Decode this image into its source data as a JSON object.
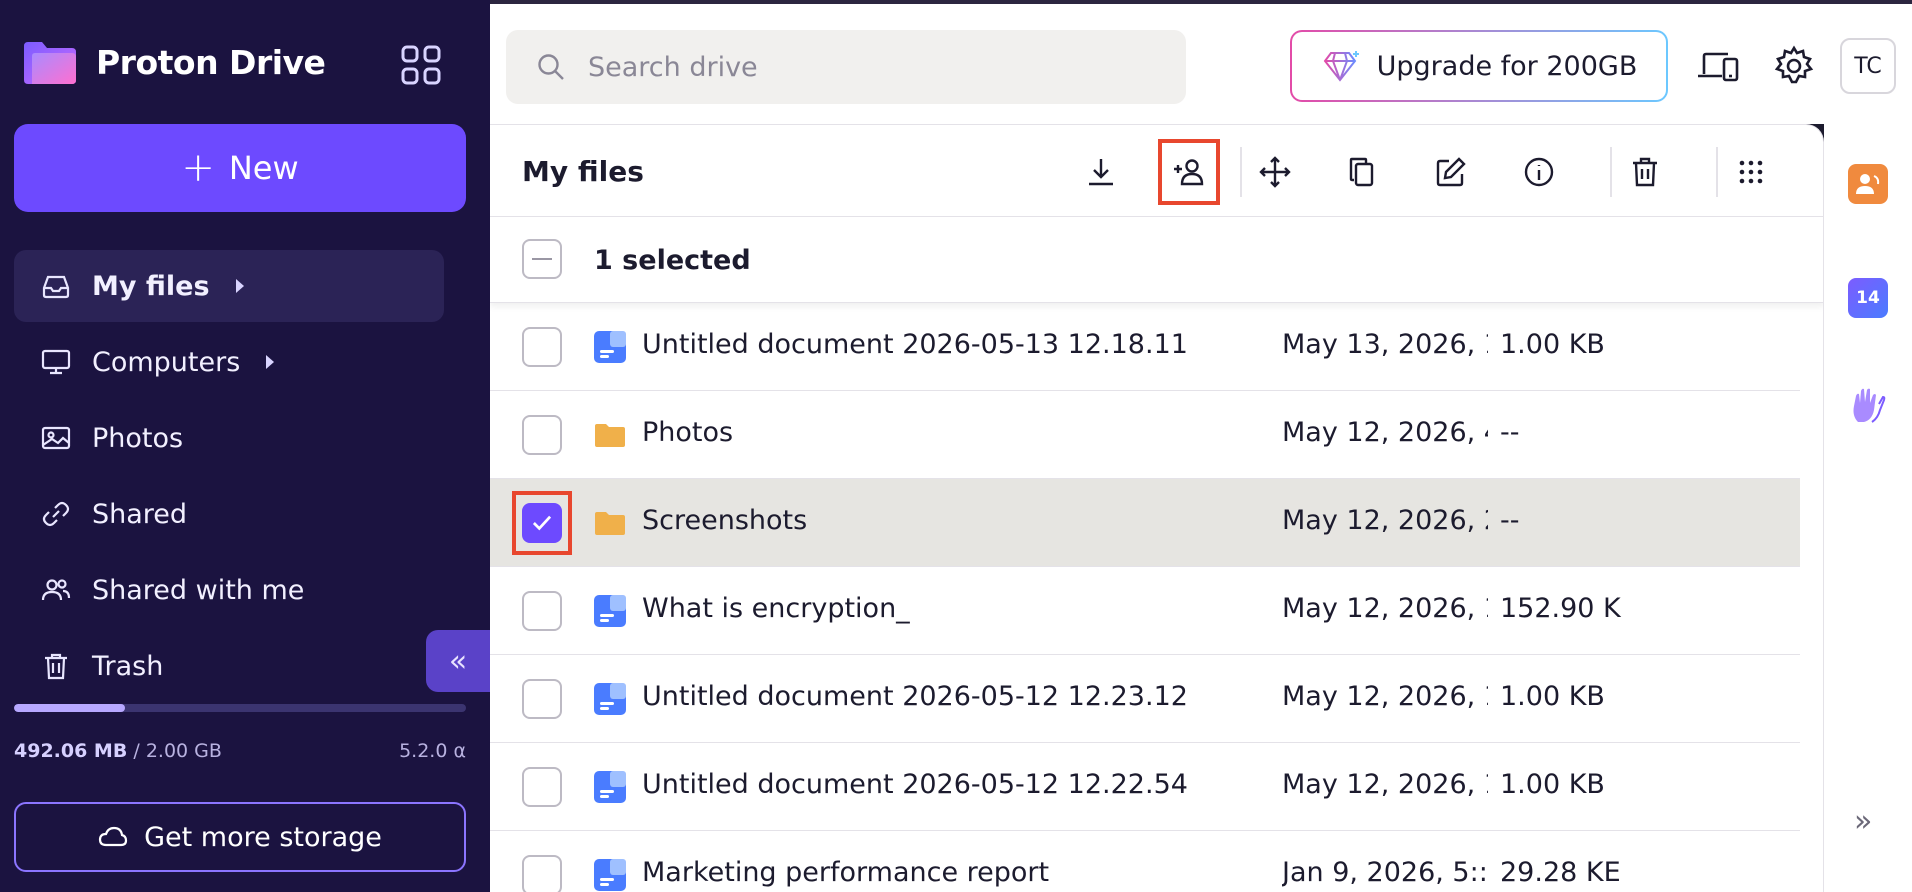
{
  "sidebar": {
    "brand": "Proton Drive",
    "new_label": "New",
    "nav": [
      {
        "label": "My files",
        "icon": "inbox-icon",
        "active": true
      },
      {
        "label": "Computers",
        "icon": "monitor-icon"
      },
      {
        "label": "Photos",
        "icon": "image-icon"
      },
      {
        "label": "Shared",
        "icon": "link-icon"
      },
      {
        "label": "Shared with me",
        "icon": "users-icon"
      },
      {
        "label": "Trash",
        "icon": "trash-icon"
      }
    ],
    "storage_used": "492.06 MB",
    "storage_total": "/ 2.00 GB",
    "storage_fraction": 0.246,
    "version": "5.2.0 α",
    "get_storage_label": "Get more storage"
  },
  "topbar": {
    "search_placeholder": "Search drive",
    "upgrade_label": "Upgrade for 200GB",
    "avatar_initials": "TC"
  },
  "main": {
    "title": "My files",
    "selection_text": "1 selected",
    "rows": [
      {
        "name": "Untitled document 2026-05-13 12.18.11",
        "type": "doc",
        "date": "May 13, 2026, 1",
        "size": "1.00 KB",
        "selected": false
      },
      {
        "name": "Photos",
        "type": "folder",
        "date": "May 12, 2026, 4",
        "size": "--",
        "selected": false
      },
      {
        "name": "Screenshots",
        "type": "folder",
        "date": "May 12, 2026, 2",
        "size": "--",
        "selected": true
      },
      {
        "name": "What is encryption_",
        "type": "doc",
        "date": "May 12, 2026, 1",
        "size": "152.90 K",
        "selected": false
      },
      {
        "name": "Untitled document 2026-05-12 12.23.12",
        "type": "doc",
        "date": "May 12, 2026, 1",
        "size": "1.00 KB",
        "selected": false
      },
      {
        "name": "Untitled document 2026-05-12 12.22.54",
        "type": "doc",
        "date": "May 12, 2026, 1",
        "size": "1.00 KB",
        "selected": false
      },
      {
        "name": "Marketing performance report",
        "type": "doc",
        "date": "Jan 9, 2026, 5::",
        "size": "29.28 KE",
        "selected": false
      }
    ]
  },
  "rail": {
    "calendar_day": "14"
  },
  "colors": {
    "accent": "#6d4aff",
    "sidebar_bg": "#1b1340",
    "highlight": "#e8472e",
    "folder": "#f0b04a"
  }
}
